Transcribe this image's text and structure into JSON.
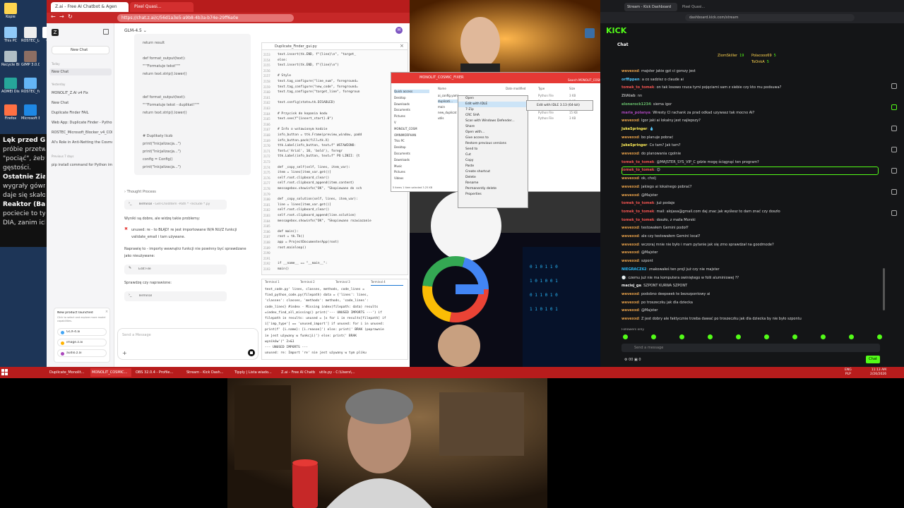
{
  "desktop": {
    "icons": [
      "Kopie",
      "This PC",
      "ROSTEC_Log",
      "OB",
      "Recycle Bin",
      "GIMP 3.0.0-2",
      "AOMEI Disk",
      "ROSTEC_fu",
      "Firefox",
      "Microsoft Edge"
    ],
    "side_text": [
      {
        "bold": "Lęk przed Gęsto",
        "rest": ""
      },
      {
        "bold": "",
        "rest": "próbie przetwor"
      },
      {
        "bold": "",
        "rest": "\"pociąć\", żeby ic"
      },
      {
        "bold": "",
        "rest": "gęstości."
      },
      {
        "bold": "Ostatnie Ziarnk",
        "rest": ""
      },
      {
        "bold": "",
        "rest": "wygrały gówno, ic"
      },
      {
        "bold": "",
        "rest": "daje się skałowani"
      },
      {
        "bold": "Reaktor (Banan",
        "rest": ""
      },
      {
        "bold": "",
        "rest": "pociecie to tylko"
      },
      {
        "bold": "",
        "rest": "DIA, zanim ich ma"
      }
    ]
  },
  "browser1": {
    "tabs": [
      "Z.ai - Free AI Chatbot & Agen",
      "Pixel Quasi..."
    ],
    "url": "https://chat.z.ai/c/56d1a3e5-a9b8-4b3a-b74e-29ff6a0e"
  },
  "zai": {
    "model": "GLM-4.5",
    "new_chat": "New Chat",
    "today": "Today",
    "items_today": [
      "New Chat"
    ],
    "yesterday": "Yesterday",
    "items_yesterday": [
      "MONOLIT_Z.AI v4 Fix",
      "New Chat",
      "Duplicate Finder FAIL",
      "Web App: Duplicate Finder - Python",
      "ROSTEC_Microsoft_Blocker_v4_COM",
      "AI's Role in Anti-Netting the Cosmos"
    ],
    "previous7": "Previous 7 days",
    "items_prev": [
      "pip install command for Python imp."
    ],
    "promo_title": "New product launched",
    "promo_text": "Click to select and explore more model capabilities.",
    "promo_items": [
      "GCX-4.ai",
      "image.z.ai",
      "audio.z.ai"
    ],
    "code1": [
      "return result",
      "",
      "def format_output(text):",
      "    \"\"\"Formatuje tekst\"\"\"",
      "    return text.strip().lower()",
      "",
      "",
      "def format_output(text):",
      "    \"\"\"Formatuje tekst - duplikat!\"\"\"",
      "    return text.strip().lower()",
      "",
      "",
      "# Duplikaty liczb",
      "print(\"Inicjalizacja...\")",
      "print(\"Inicjalizacja...\")",
      "config = Config()",
      "print(\"Inicjalizacja...\")"
    ],
    "thought": "Thought Process",
    "terminal_label": "Terminal",
    "terminal_cmd": "Get-ChildItem -Path * -Include *.py",
    "result_line": "Wyniki są dobre, ale widzę takie problemy:",
    "result_detail": "unused: re - to BŁĄD! re jest importowane W/A NU/Z funkcji validate_email i tam używane.",
    "fix_line": "Naprawię to - importy wewnątrz funkcji nie powinny być sprawdzane jako nieużywane:",
    "edit_file": "Edit File",
    "check_line": "Sprawdzę czy naprawione:",
    "terminal2": "Terminal",
    "input_placeholder": "Send a Message"
  },
  "codepane": {
    "title": "Duplicate_Finder_gui.py",
    "lines": [
      "            text.insert(tk.END, f\"{line}\\n\", \"target_",
      "          else:",
      "            text.insert(tk.END, f\"{line}\\n\")",
      "",
      "    # Style",
      "    text.tag_configure(\"line_num\", foreground=",
      "    text.tag_configure(\"new_code\", foreground=",
      "    text.tag_configure(\"target_line\", foregroun",
      "",
      "    text.config(state=tk.DISABLED)",
      "",
      "    # Przycisk do kopania kodu",
      "    text.see(f\"{insert_start}.0\")",
      "",
      "    # Info o wstawionym kodzie",
      "    info_button = ttk.Frame(preview_window, padd",
      "    info_button.pack(fill=tk.X)",
      "    ttk.Label(info_button, text=f\"  WSTAWIONO: ",
      "              font=('Arial', 10, 'bold'), foregr",
      "    ttk.Label(info_button, text=f\"  PO LINII: {t",
      "",
      "  def _copy_self(self, lines, item_var):",
      "    item = lines[item_var.get()]",
      "    self.root.clipboard_clear()",
      "    self.root.clipboard_append(item.content)",
      "    messagebox.showinfo(\"OK\", \"Skopiowano do sch",
      "",
      "  def _copy_solution(self, lines, item_var):",
      "    line = lines[item_var.get()]",
      "    self.root.clipboard_clear()",
      "    self.root.clipboard_append(line.solution)",
      "    messagebox.showinfo(\"OK\", \"Skopiowano rozwiazanie",
      "",
      "def main():",
      "    root = tk.Tk()",
      "    app = ProjectDocumenterApp(root)",
      "    root.mainloop()",
      "",
      "",
      "if __name__ == \"__main__\":",
      "    main()"
    ],
    "linenum_start": 2153
  },
  "termpane": {
    "tabs": [
      "Terminal 1",
      "Terminal 2",
      "Terminal 3",
      "Terminal 4"
    ],
    "lines": [
      "text_code.py' lines, classes, methods, code_lines =",
      "find_python_code.py(filepath) data = {'lines': lines,",
      "'classes': classes, 'methods': methods, 'code_lines':",
      "code_lines} #index - Missing index(filepath: data) results",
      "=index_find_all_missing() print('--- UNUSED IMPORTS ---') if",
      "filepath in results: unused = [x for i in results[filepath] if",
      "i['imp_type'] == 'unused_import'] if unused: for i in unused:",
      "print(f' {i.name}: [i.reason]') else: print(' BRAK (poprawnie",
      "ie jest używany w funkcji)') else: print(' BRAK",
      "wyników')\" 2>&1",
      "--- UNUSED IMPORTS ---",
      "  unused: re: Import 're' nie jest używany w tym pliku"
    ]
  },
  "explorer": {
    "title": "MONOLIT_COSMIC_FIXER",
    "search": "Search MONOLIT_COSMIC_FI...",
    "nav": [
      "Quick access",
      "Desktop",
      "Downloads",
      "Documents",
      "Pictures",
      "V",
      "MONOLIT_COSM",
      "OMNIMORPHAN",
      "This PC",
      "Desktop",
      "Documents",
      "Downloads",
      "Music",
      "Pictures",
      "Videos"
    ],
    "headers": [
      "Name",
      "Date modified",
      "Type",
      "Size"
    ],
    "files": [
      "ai_config.yaml",
      "duplicati...",
      "main",
      "new_duplicat",
      "utils"
    ],
    "types": [
      "Python File",
      "Python File",
      "Python File",
      "Python File",
      "Python File"
    ],
    "sizes": [
      "3 KB",
      "3 KB",
      "11 KB",
      "15 KB",
      "3 KB"
    ],
    "status": "5 items  1 item selected 3.25 KB"
  },
  "context_menu": {
    "items": [
      "Open",
      "Edit with IDLE",
      "7-Zip",
      "CRC SHA",
      "Scan with Windows Defender...",
      "Share",
      "Open with...",
      "Give access to",
      "Restore previous versions",
      "Send to",
      "Cut",
      "Copy",
      "Paste",
      "Create shortcut",
      "Delete",
      "Rename",
      "Permanently delete",
      "Properties"
    ],
    "submenu": "Edit with IDLE 3.13 (64-bit)"
  },
  "kick": {
    "tabs": [
      "Stream - Kick Dashboard",
      "Pixel Quasi..."
    ],
    "url": "dashboard.kick.com/stream",
    "logo": "KICK",
    "chat_title": "Chat",
    "top_gifters": [
      {
        "name": "ZiomSkiller",
        "n": "19"
      },
      {
        "name": "Polacooo69",
        "n": "5"
      },
      {
        "name": "ToOnkA",
        "n": "5"
      }
    ],
    "messages": [
      {
        "u": "wevexxd",
        "c": "#e6a04a",
        "t": "majster jakie gpt ci gorszy jest"
      },
      {
        "u": "orffippen",
        "c": "#4fc3f7",
        "t": "a co sadzisz o claude ai"
      },
      {
        "u": "tomek_to_tomek",
        "c": "#ef5350",
        "t": "on tak losowo rzuca tymi pojęciami sam z siebie czy kto mu podsuwa?"
      },
      {
        "u": "ZilAlab",
        "c": "#aaa",
        "t": "nn"
      },
      {
        "u": "elonerock1234",
        "c": "#66bb6a",
        "t": "siema igor"
      },
      {
        "u": "maria_polanya",
        "c": "#ab47bc",
        "t": "Wiresty Cl rachank za prad odkad uzywasz tak mocno AI?"
      },
      {
        "u": "wevexxd",
        "c": "#e6a04a",
        "t": "Igor jaki ai lokalny jest najlepszy?"
      },
      {
        "u": "JukeSpringer",
        "c": "#ffee58",
        "t": "💧"
      },
      {
        "u": "wevexxd",
        "c": "#e6a04a",
        "t": "bo planuje pobrać"
      },
      {
        "u": "JukeSpringer",
        "c": "#ffee58",
        "t": "Co tam? Jak tam?"
      },
      {
        "u": "wevexxd",
        "c": "#e6a04a",
        "t": "do planowania cgolnie"
      },
      {
        "u": "tomek_to_tomek",
        "c": "#ef5350",
        "t": "@MAJSTER_SYS_VIP_C gdzie mogę ściągnąć ten program?"
      },
      {
        "u": "tomek_to_tomek",
        "c": "#ef5350",
        "t": "😉"
      },
      {
        "u": "wevexxd",
        "c": "#e6a04a",
        "t": "ok, cholj"
      },
      {
        "u": "wevexxd",
        "c": "#e6a04a",
        "t": "jakiego ai lokalnego pobrać?"
      },
      {
        "u": "wevexxd",
        "c": "#e6a04a",
        "t": "@Majster"
      },
      {
        "u": "tomek_to_tomek",
        "c": "#ef5350",
        "t": "już podaje"
      },
      {
        "u": "tomek_to_tomek",
        "c": "#ef5350",
        "t": "mail: alojasa@gmail.com daj znac jak wyślesz to dam znać czy doszło"
      },
      {
        "u": "tomek_to_tomek",
        "c": "#ef5350",
        "t": "doszło, z maila Morski"
      },
      {
        "u": "wevexxd",
        "c": "#e6a04a",
        "t": "testowałem Gemini podoł?"
      },
      {
        "u": "wevexxd",
        "c": "#e6a04a",
        "t": "ale czy testowałem Gemini local?"
      },
      {
        "u": "wevexxd",
        "c": "#e6a04a",
        "t": "wczoraj mnie nie było i mam pytanie jak się zmo sprawdzał na goodmode?"
      },
      {
        "u": "wevexxd",
        "c": "#e6a04a",
        "t": "@Majster"
      },
      {
        "u": "wevexxd",
        "c": "#e6a04a",
        "t": "szpont"
      },
      {
        "u": "NIEGRACZ62",
        "c": "#29b6f6",
        "t": "znakowałeś ten projl już czy nie majster"
      },
      {
        "u": "🕐",
        "c": "#ffb300",
        "t": "czemu już nie ma komputera owiniętego w folii aluminiowej ??"
      },
      {
        "u": "maciej_ga",
        "c": "#eee",
        "t": "SZPONT KURWA SZPONT"
      },
      {
        "u": "wevexxd",
        "c": "#e6a04a",
        "t": "podobno deepseek te bezszpontowy ai"
      },
      {
        "u": "wevexxd",
        "c": "#e6a04a",
        "t": "po troszeczku jak dla dziecka"
      },
      {
        "u": "wevexxd",
        "c": "#e6a04a",
        "t": "@Majster"
      },
      {
        "u": "wevexxd",
        "c": "#e6a04a",
        "t": "Z jest dobry ale faktycznie trzeba dawać po troszeczku jak dla dziecka by nie było szpontu"
      }
    ],
    "followers": "Followers only",
    "send_placeholder": "Send a message",
    "count": "00",
    "count2": "0",
    "chat_button": "Chat"
  },
  "taskbar": {
    "items": [
      "Duplicate_Monolit...",
      "MONOLIT_COSMIC...",
      "OBS 32.0.4 - Profile...",
      "Stream - Kick Dash...",
      "Tipply | Lista wiado...",
      "Z.ai - Free AI Chatb...",
      "utils.py - C:\\Users\\..."
    ],
    "lang": "ENG",
    "lang2": "PLP",
    "time": "11:13 AM",
    "date": "2/26/2026"
  },
  "colors": {
    "accent_red": "#b71c1c",
    "kick_green": "#53fc18",
    "bg_dark": "#141517"
  }
}
